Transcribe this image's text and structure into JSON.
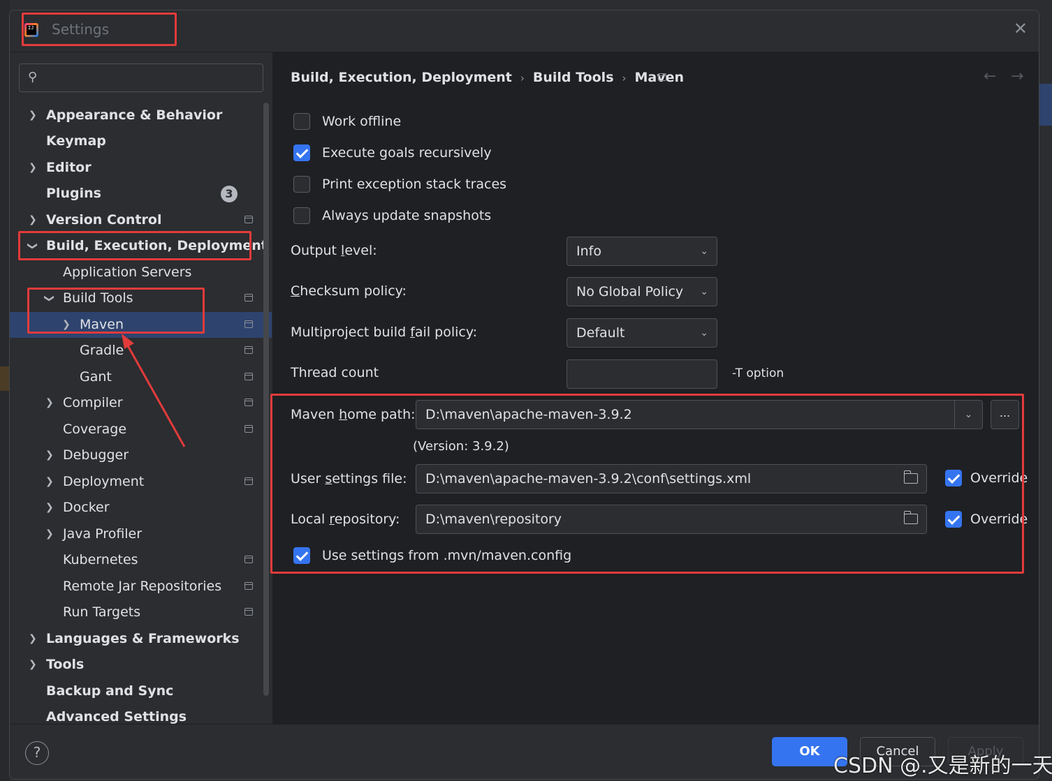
{
  "window": {
    "title": "Settings",
    "close_glyph": "✕",
    "logo_text": "IJ"
  },
  "search": {
    "icon": "search-icon",
    "placeholder": ""
  },
  "sidebar": {
    "items": [
      {
        "label": "Appearance & Behavior",
        "has_chevron": true
      },
      {
        "label": "Keymap"
      },
      {
        "label": "Editor",
        "has_chevron": true
      },
      {
        "label": "Plugins",
        "badge": "3"
      },
      {
        "label": "Version Control",
        "has_chevron": true
      },
      {
        "label": "Build, Execution, Deployment",
        "expanded": true
      },
      {
        "label": "Application Servers"
      },
      {
        "label": "Build Tools",
        "expanded": true
      },
      {
        "label": "Maven",
        "selected": true
      },
      {
        "label": "Gradle"
      },
      {
        "label": "Gant"
      },
      {
        "label": "Compiler"
      },
      {
        "label": "Coverage"
      },
      {
        "label": "Debugger"
      },
      {
        "label": "Deployment"
      },
      {
        "label": "Docker"
      },
      {
        "label": "Java Profiler"
      },
      {
        "label": "Kubernetes"
      },
      {
        "label": "Remote Jar Repositories"
      },
      {
        "label": "Run Targets"
      },
      {
        "label": "Languages & Frameworks"
      },
      {
        "label": "Tools"
      },
      {
        "label": "Backup and Sync"
      },
      {
        "label": "Advanced Settings"
      }
    ]
  },
  "breadcrumb": {
    "items": [
      "Build, Execution, Deployment",
      "Build Tools",
      "Maven"
    ],
    "sep": "›",
    "back": "←",
    "forward": "→"
  },
  "options": {
    "work_offline": {
      "label": "Work offline",
      "checked": false
    },
    "execute_goals": {
      "label": "Execute goals recursively",
      "checked": true
    },
    "print_stack": {
      "label": "Print exception stack traces",
      "checked": false
    },
    "always_update": {
      "label": "Always update snapshots",
      "checked": false
    }
  },
  "form": {
    "output_level": {
      "label_pre": "Output ",
      "label_mn": "l",
      "label_post": "evel:",
      "value": "Info"
    },
    "checksum": {
      "label_mn": "C",
      "label_post": "hecksum policy:",
      "value": "No Global Policy"
    },
    "multiproject": {
      "label_pre": "Multiproject build ",
      "label_mn": "f",
      "label_post": "ail policy:",
      "value": "Default"
    },
    "thread_count": {
      "label": "Thread count",
      "value": "",
      "hint": "-T option"
    },
    "maven_home": {
      "label_pre": "Maven ",
      "label_mn": "h",
      "label_post": "ome path:",
      "value": "D:\\maven\\apache-maven-3.9.2",
      "version": "(Version: 3.9.2)",
      "browse": "..."
    },
    "user_settings": {
      "label_pre": "User ",
      "label_mn": "s",
      "label_post": "ettings file:",
      "value": "D:\\maven\\apache-maven-3.9.2\\conf\\settings.xml",
      "override": "Override",
      "override_checked": true
    },
    "local_repo": {
      "label_pre": "Local ",
      "label_mn": "r",
      "label_post": "epository:",
      "value": "D:\\maven\\repository",
      "override": "Override",
      "override_checked": true
    },
    "use_mvn_config": {
      "label": "Use settings from .mvn/maven.config",
      "checked": true
    }
  },
  "footer": {
    "help": "?",
    "ok": "OK",
    "cancel": "Cancel",
    "apply": "Apply"
  },
  "watermark": "CSDN @.又是新的一天.",
  "colors": {
    "accent": "#3574f0",
    "annotation": "#e33b3b",
    "selection": "#2e436e"
  }
}
